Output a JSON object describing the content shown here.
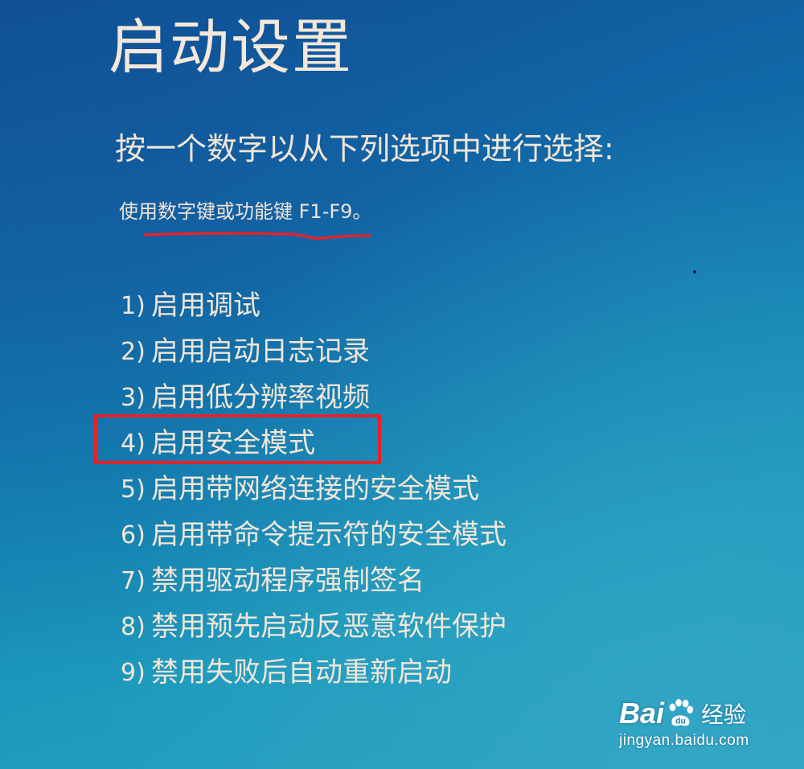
{
  "screen": {
    "title": "启动设置",
    "instruction": "按一个数字以从下列选项中进行选择:",
    "hint": "使用数字键或功能键 F1-F9。"
  },
  "options": [
    {
      "num": "1)",
      "label": "启用调试"
    },
    {
      "num": "2)",
      "label": "启用启动日志记录"
    },
    {
      "num": "3)",
      "label": "启用低分辨率视频"
    },
    {
      "num": "4)",
      "label": "启用安全模式"
    },
    {
      "num": "5)",
      "label": "启用带网络连接的安全模式"
    },
    {
      "num": "6)",
      "label": "启用带命令提示符的安全模式"
    },
    {
      "num": "7)",
      "label": "禁用驱动程序强制签名"
    },
    {
      "num": "8)",
      "label": "禁用预先启动反恶意软件保护"
    },
    {
      "num": "9)",
      "label": "禁用失败后自动重新启动"
    }
  ],
  "annotation": {
    "highlighted_option_index": 3,
    "highlight_color": "#e3232a",
    "underline_color": "#e3232a"
  },
  "watermark": {
    "logo_left": "Bai",
    "logo_right": "du",
    "logo_suffix": "经验",
    "url": "jingyan.baidu.com",
    "paw_icon": "baidu-paw-icon"
  },
  "colors": {
    "text": "#f3e6d8",
    "background_top": "#0f4f95",
    "background_bottom": "#2aa2c0"
  }
}
